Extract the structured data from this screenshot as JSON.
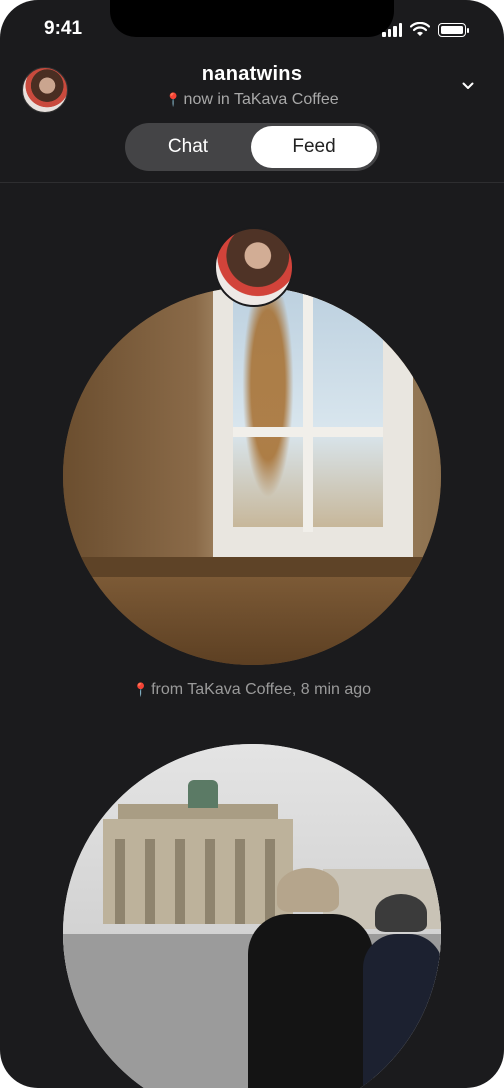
{
  "status_bar": {
    "time": "9:41"
  },
  "header": {
    "username": "nanatwins",
    "location_text": "now in TaKava Coffee",
    "collapse_icon": "chevron-down-icon"
  },
  "segmented_control": {
    "options": [
      "Chat",
      "Feed"
    ],
    "selected": "Feed"
  },
  "feed": {
    "posts": [
      {
        "caption": "from TaKava Coffee, 8 min ago"
      }
    ]
  },
  "colors": {
    "background": "#1b1b1d",
    "segment_bg": "#444446",
    "segment_selected_bg": "#ffffff",
    "pin": "#e04040",
    "secondary_text": "#a8a8a8"
  }
}
